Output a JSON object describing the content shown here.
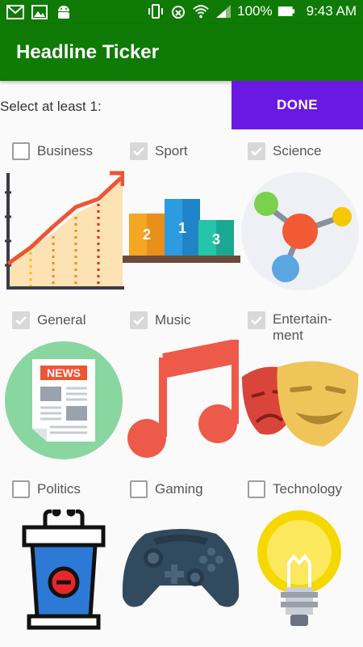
{
  "status_bar": {
    "battery": "100%",
    "time": "9:43 AM"
  },
  "app": {
    "title": "Headline Ticker"
  },
  "selection": {
    "prompt": "Select at least 1:",
    "done_label": "DONE"
  },
  "categories": [
    {
      "label": "Business",
      "checked": false,
      "icon": "business-chart-icon"
    },
    {
      "label": "Sport",
      "checked": true,
      "icon": "podium-icon"
    },
    {
      "label": "Science",
      "checked": true,
      "icon": "molecule-icon"
    },
    {
      "label": "General",
      "checked": true,
      "icon": "newspaper-icon"
    },
    {
      "label": "Music",
      "checked": true,
      "icon": "music-note-icon"
    },
    {
      "label": "Entertain-\nment",
      "checked": true,
      "icon": "theater-masks-icon"
    },
    {
      "label": "Politics",
      "checked": false,
      "icon": "podium-politics-icon"
    },
    {
      "label": "Gaming",
      "checked": false,
      "icon": "game-controller-icon"
    },
    {
      "label": "Technology",
      "checked": false,
      "icon": "lightbulb-icon"
    }
  ],
  "colors": {
    "app_bar": "#0f7a05",
    "done_button": "#6a19e3",
    "background": "#fafafa"
  }
}
